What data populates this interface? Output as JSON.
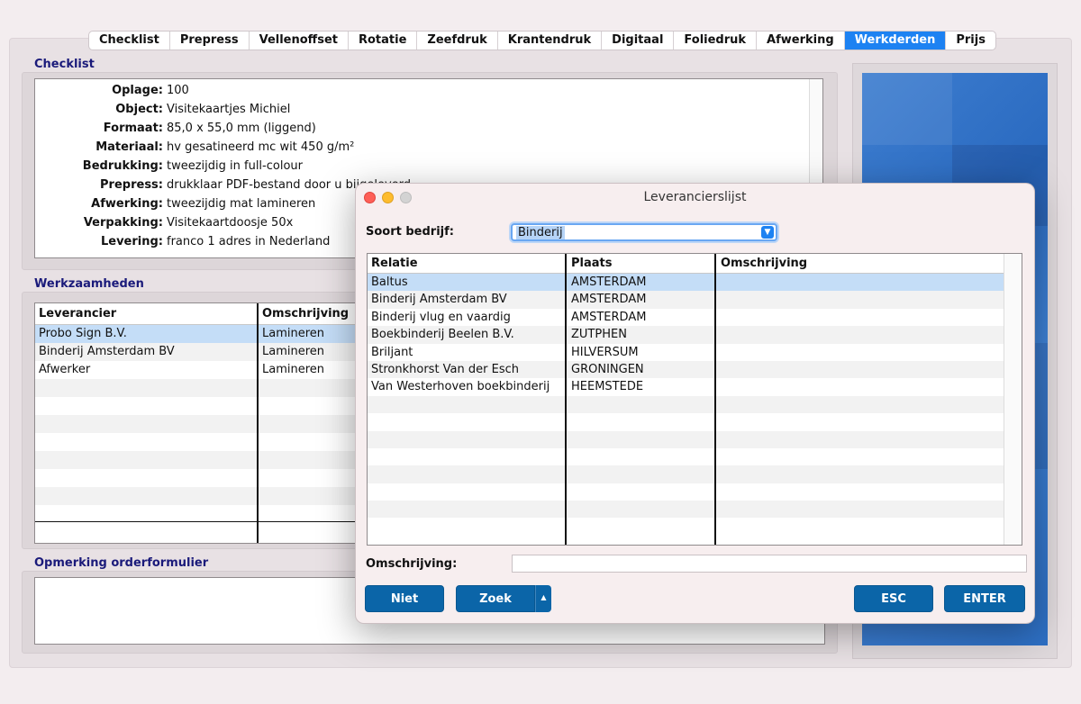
{
  "tabs": [
    {
      "label": "Checklist",
      "active": false
    },
    {
      "label": "Prepress",
      "active": false
    },
    {
      "label": "Vellenoffset",
      "active": false
    },
    {
      "label": "Rotatie",
      "active": false
    },
    {
      "label": "Zeefdruk",
      "active": false
    },
    {
      "label": "Krantendruk",
      "active": false
    },
    {
      "label": "Digitaal",
      "active": false
    },
    {
      "label": "Foliedruk",
      "active": false
    },
    {
      "label": "Afwerking",
      "active": false
    },
    {
      "label": "Werkderden",
      "active": true
    },
    {
      "label": "Prijs",
      "active": false
    }
  ],
  "checklist": {
    "title": "Checklist",
    "rows": [
      {
        "label": "Oplage:",
        "value": "100"
      },
      {
        "label": "Object:",
        "value": "Visitekaartjes Michiel"
      },
      {
        "label": "Formaat:",
        "value": "85,0 x 55,0 mm (liggend)"
      },
      {
        "label": "Materiaal:",
        "value": "hv gesatineerd mc wit 450 g/m²"
      },
      {
        "label": "Bedrukking:",
        "value": "tweezijdig in full-colour"
      },
      {
        "label": "Prepress:",
        "value": "drukklaar PDF-bestand door u bijgeleverd"
      },
      {
        "label": "Afwerking:",
        "value": "tweezijdig mat lamineren"
      },
      {
        "label": "Verpakking:",
        "value": "Visitekaartdoosje 50x"
      },
      {
        "label": "Levering:",
        "value": "franco 1 adres in Nederland"
      }
    ]
  },
  "werkzaamheden": {
    "title": "Werkzaamheden",
    "columns": [
      "Leverancier",
      "Omschrijving"
    ],
    "rows": [
      {
        "leverancier": "Probo Sign B.V.",
        "omschrijving": "Lamineren",
        "selected": true
      },
      {
        "leverancier": "Binderij Amsterdam BV",
        "omschrijving": "Lamineren",
        "selected": false
      },
      {
        "leverancier": "Afwerker",
        "omschrijving": "Lamineren",
        "selected": false
      }
    ]
  },
  "opmerking": {
    "title": "Opmerking orderformulier"
  },
  "dialog": {
    "title": "Leverancierslijst",
    "soort_label": "Soort bedrijf:",
    "soort_value": "Binderij",
    "columns": [
      "Relatie",
      "Plaats",
      "Omschrijving"
    ],
    "rows": [
      {
        "relatie": "Baltus",
        "plaats": "AMSTERDAM",
        "omschrijving": "",
        "selected": true
      },
      {
        "relatie": "Binderij Amsterdam BV",
        "plaats": "AMSTERDAM",
        "omschrijving": "",
        "selected": false
      },
      {
        "relatie": "Binderij vlug en vaardig",
        "plaats": "AMSTERDAM",
        "omschrijving": "",
        "selected": false
      },
      {
        "relatie": "Boekbinderij Beelen B.V.",
        "plaats": "ZUTPHEN",
        "omschrijving": "",
        "selected": false
      },
      {
        "relatie": "Briljant",
        "plaats": "HILVERSUM",
        "omschrijving": "",
        "selected": false
      },
      {
        "relatie": "Stronkhorst Van der Esch",
        "plaats": "GRONINGEN",
        "omschrijving": "",
        "selected": false
      },
      {
        "relatie": "Van Westerhoven boekbinderij",
        "plaats": "HEEMSTEDE",
        "omschrijving": "",
        "selected": false
      }
    ],
    "omschrijving_label": "Omschrijving:",
    "omschrijving_value": "",
    "buttons": {
      "niet": "Niet",
      "zoek": "Zoek",
      "esc": "ESC",
      "enter": "ENTER"
    }
  }
}
